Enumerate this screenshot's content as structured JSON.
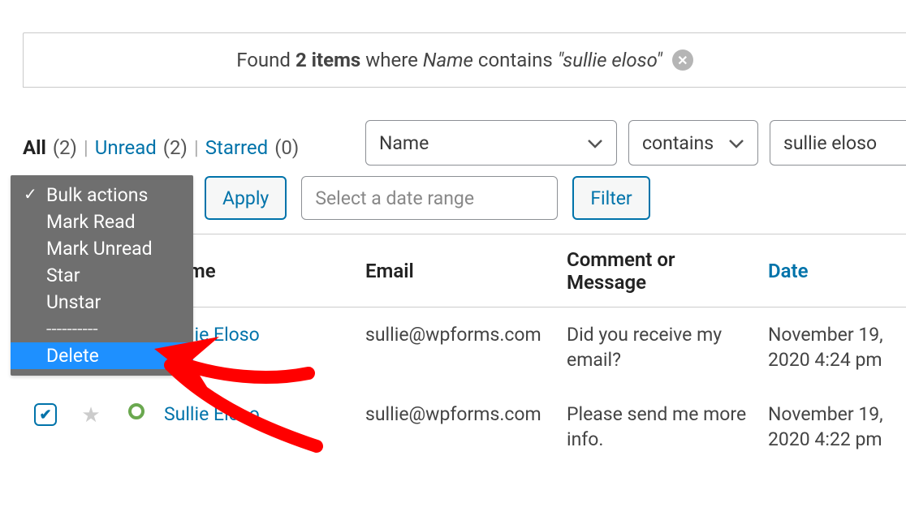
{
  "filter_result": {
    "prefix": "Found",
    "count": "2 items",
    "where": "where",
    "field": "Name",
    "contains": "contains",
    "term": "\"sullie eloso\""
  },
  "tabs": {
    "all_label": "All",
    "all_count": "(2)",
    "unread_label": "Unread",
    "unread_count": "(2)",
    "starred_label": "Starred",
    "starred_count": "(0)"
  },
  "filters": {
    "field_select": "Name",
    "condition_select": "contains",
    "term_input": "sullie eloso"
  },
  "actions": {
    "apply_label": "Apply",
    "date_placeholder": "Select a date range",
    "filter_label": "Filter"
  },
  "bulk_menu": {
    "items": [
      "Bulk actions",
      "Mark Read",
      "Mark Unread",
      "Star",
      "Unstar"
    ],
    "separator": "----------",
    "delete": "Delete"
  },
  "table": {
    "headers": {
      "name": "Name",
      "email": "Email",
      "comment": "Comment or Message",
      "date": "Date"
    },
    "rows": [
      {
        "name": "Sullie Eloso",
        "email": "sullie@wpforms.com",
        "comment": "Did you receive my email?",
        "date": "November 19, 2020 4:24 pm"
      },
      {
        "name": "Sullie Eloso",
        "email": "sullie@wpforms.com",
        "comment": "Please send me more info.",
        "date": "November 19, 2020 4:22 pm"
      }
    ]
  }
}
